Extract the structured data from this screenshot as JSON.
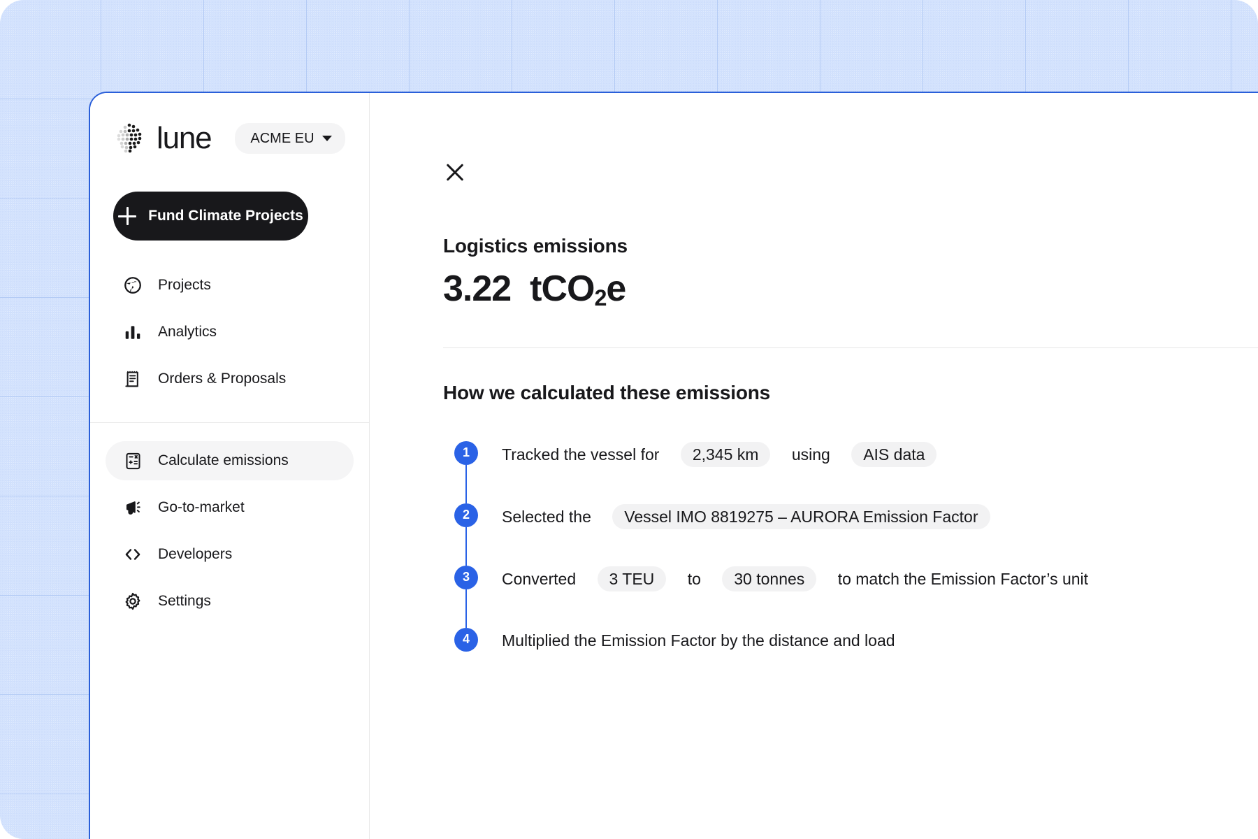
{
  "brand": {
    "wordmark": "lune",
    "logo_icon": "lune-dot-grid-icon",
    "org_selector": {
      "label": "ACME EU",
      "caret_icon": "chevron-down-icon"
    }
  },
  "primary_action": {
    "label": "Fund Climate Projects",
    "icon": "plus-icon"
  },
  "sidebar": {
    "groups": [
      {
        "items": [
          {
            "label": "Projects",
            "icon": "globe-icon",
            "active": false
          },
          {
            "label": "Analytics",
            "icon": "bar-chart-icon",
            "active": false
          },
          {
            "label": "Orders & Proposals",
            "icon": "receipt-icon",
            "active": false
          }
        ]
      },
      {
        "items": [
          {
            "label": "Calculate emissions",
            "icon": "calculator-icon",
            "active": true
          },
          {
            "label": "Go-to-market",
            "icon": "megaphone-icon",
            "active": false
          },
          {
            "label": "Developers",
            "icon": "code-brackets-icon",
            "active": false
          },
          {
            "label": "Settings",
            "icon": "gear-icon",
            "active": false
          }
        ]
      }
    ]
  },
  "main": {
    "close_icon": "close-icon",
    "panel_title": "Logistics emissions",
    "metric": {
      "value": "3.22",
      "unit_prefix": "tCO",
      "unit_sub": "2",
      "unit_suffix": "e",
      "full": "3.22 tCO2e"
    },
    "section_title": "How we calculated these emissions",
    "steps": [
      {
        "number": "1",
        "parts": [
          {
            "type": "text",
            "value": "Tracked the vessel for"
          },
          {
            "type": "pill",
            "value": "2,345 km"
          },
          {
            "type": "text",
            "value": "using"
          },
          {
            "type": "pill",
            "value": "AIS data"
          }
        ]
      },
      {
        "number": "2",
        "parts": [
          {
            "type": "text",
            "value": "Selected the"
          },
          {
            "type": "pill",
            "value": "Vessel IMO 8819275 – AURORA Emission Factor"
          }
        ]
      },
      {
        "number": "3",
        "parts": [
          {
            "type": "text",
            "value": "Converted"
          },
          {
            "type": "pill",
            "value": "3 TEU"
          },
          {
            "type": "text",
            "value": "to"
          },
          {
            "type": "pill",
            "value": "30 tonnes"
          },
          {
            "type": "text",
            "value": "to match the Emission Factor’s unit"
          }
        ]
      },
      {
        "number": "4",
        "parts": [
          {
            "type": "text",
            "value": "Multiplied the Emission Factor by the distance and load"
          }
        ]
      }
    ]
  },
  "colors": {
    "backdrop": "#d3e2fd",
    "window_border": "#2a5fd9",
    "accent_blue": "#2a62e6",
    "ink": "#18181b",
    "pill_bg": "#f2f2f3",
    "active_nav_bg": "#f5f5f6"
  }
}
